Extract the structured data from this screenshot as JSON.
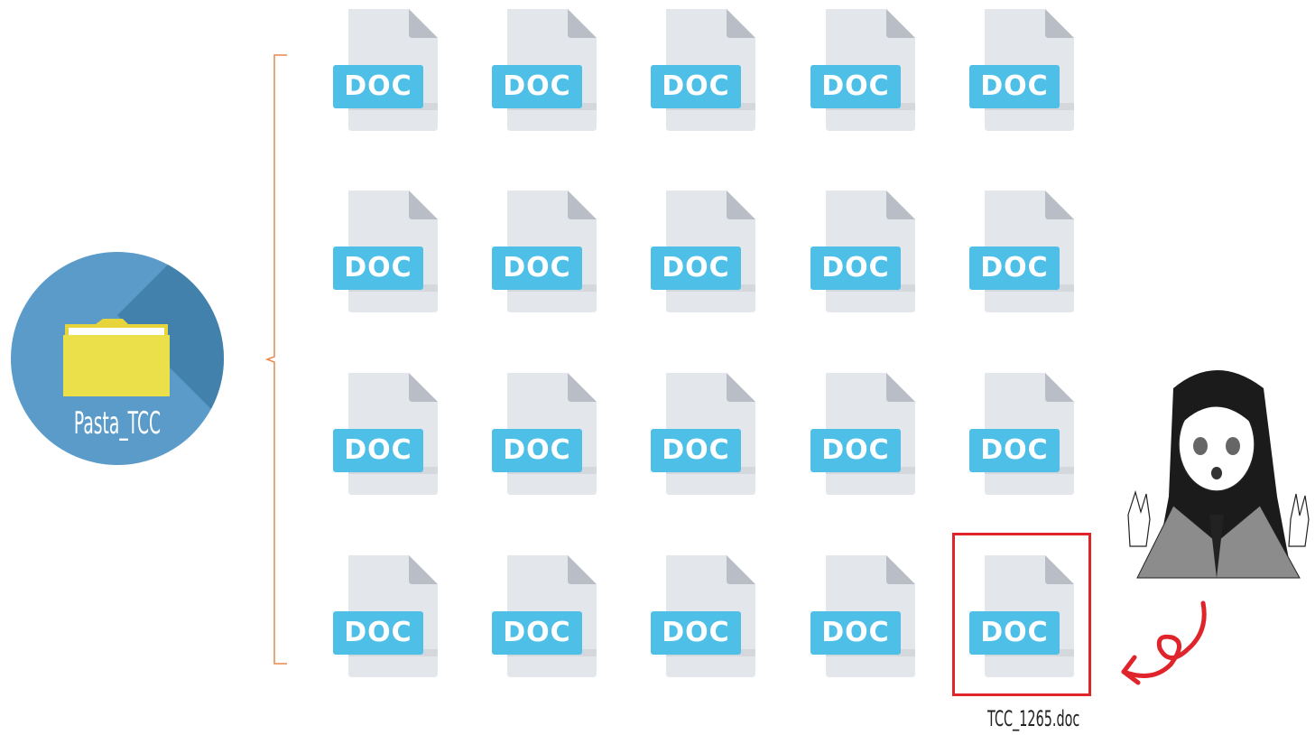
{
  "folder": {
    "label": "Pasta_TCC",
    "icon": "folder-icon"
  },
  "doc_label": "DOC",
  "grid": {
    "rows": [
      [
        "DOC",
        "DOC",
        "DOC",
        "DOC",
        "DOC"
      ],
      [
        "DOC",
        "DOC",
        "DOC",
        "DOC",
        "DOC"
      ],
      [
        "DOC",
        "DOC",
        "DOC",
        "DOC",
        "DOC"
      ],
      [
        "DOC",
        "DOC",
        "DOC",
        "DOC",
        "DOC"
      ]
    ]
  },
  "highlighted_file": {
    "caption": "TCC_1265.doc"
  },
  "colors": {
    "badge": "#5b9bc9",
    "doc_tag": "#4ebfe7",
    "doc_page": "#e3e6ea",
    "highlight": "#e0242b",
    "bracket": "#e8874a"
  }
}
